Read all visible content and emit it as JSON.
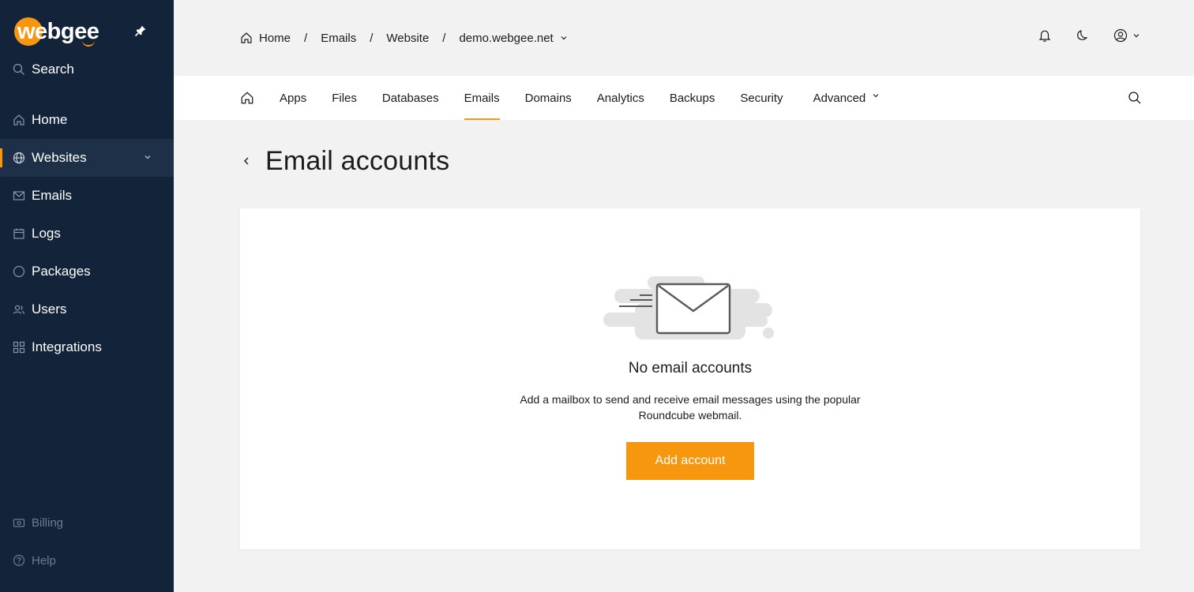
{
  "brand": {
    "name": "webgee",
    "accent": "#f7960f",
    "sidebar_bg": "#13233a"
  },
  "sidebar": {
    "search_label": "Search",
    "items": [
      {
        "label": "Home",
        "icon": "home-icon"
      },
      {
        "label": "Websites",
        "icon": "globe-icon",
        "active": true
      },
      {
        "label": "Emails",
        "icon": "mail-icon"
      },
      {
        "label": "Logs",
        "icon": "calendar-icon"
      },
      {
        "label": "Packages",
        "icon": "circle-icon"
      },
      {
        "label": "Users",
        "icon": "users-icon"
      },
      {
        "label": "Integrations",
        "icon": "grid-icon"
      }
    ],
    "bottom_items": [
      {
        "label": "Billing",
        "icon": "billing-icon"
      },
      {
        "label": "Help",
        "icon": "help-icon"
      }
    ]
  },
  "breadcrumb": {
    "items": [
      "Home",
      "Emails",
      "Website",
      "demo.webgee.net"
    ]
  },
  "tabs": {
    "items": [
      "Apps",
      "Files",
      "Databases",
      "Emails",
      "Domains",
      "Analytics",
      "Backups",
      "Security"
    ],
    "active": "Emails",
    "advanced_label": "Advanced"
  },
  "page": {
    "title": "Email accounts",
    "empty_title": "No email accounts",
    "empty_description": "Add a mailbox to send and receive email messages using the popular Roundcube webmail.",
    "add_button": "Add account"
  }
}
